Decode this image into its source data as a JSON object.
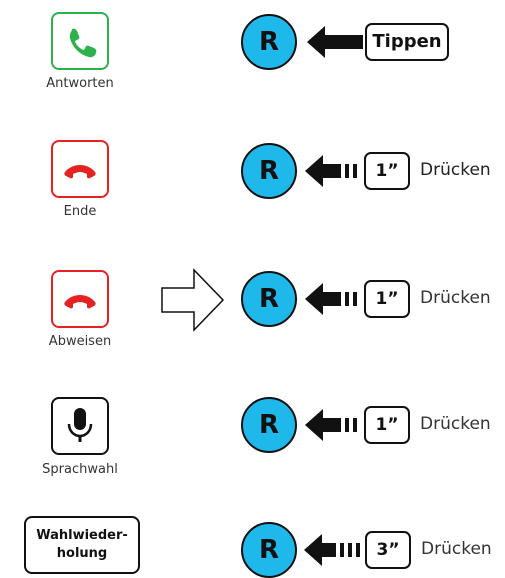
{
  "rows": [
    {
      "caption": "Antworten",
      "icon": "phone-answer-icon",
      "button": "R",
      "key": "Tippen",
      "action": ""
    },
    {
      "caption": "Ende",
      "icon": "phone-hangup-icon",
      "button": "R",
      "key": "1”",
      "action": "Drücken"
    },
    {
      "caption": "Abweisen",
      "icon": "phone-hangup-icon",
      "button": "R",
      "key": "1”",
      "action": "Drücken"
    },
    {
      "caption": "Sprachwahl",
      "icon": "microphone-icon",
      "button": "R",
      "key": "1”",
      "action": "Drücken"
    },
    {
      "caption": "Wahlwieder-\nholung",
      "icon": "",
      "button": "R",
      "key": "3”",
      "action": "Drücken"
    }
  ],
  "colors": {
    "button_fill": "#1fb8ea",
    "answer_green": "#2bb24c",
    "hangup_red": "#e52222"
  }
}
